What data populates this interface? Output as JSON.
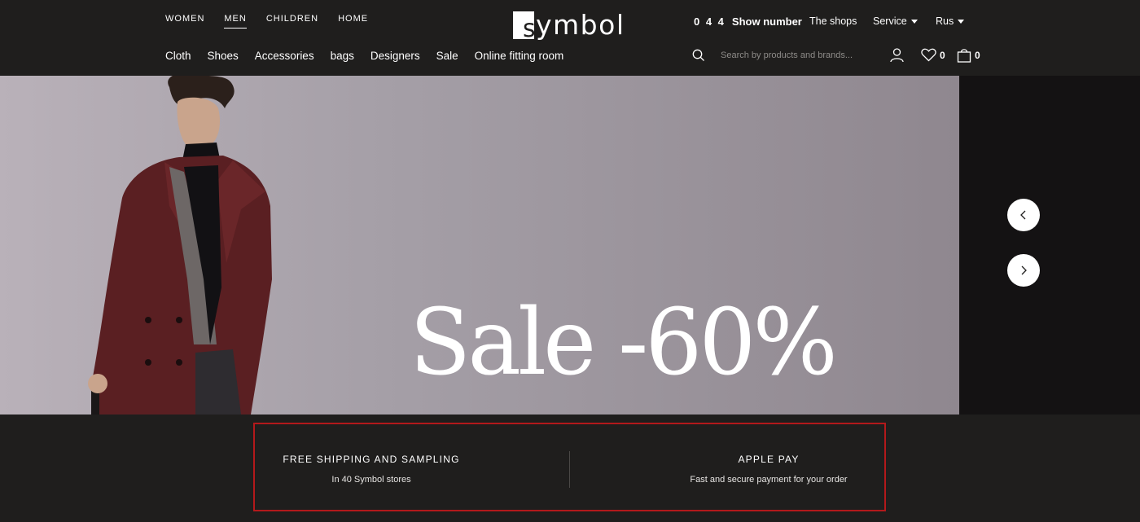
{
  "header": {
    "top_nav": [
      "WOMEN",
      "MEN",
      "CHILDREN",
      "HOME"
    ],
    "top_nav_active": "MEN",
    "categories": [
      "Cloth",
      "Shoes",
      "Accessories",
      "bags",
      "Designers",
      "Sale",
      "Online fitting room"
    ],
    "logo": {
      "boxed_letter": "s",
      "rest": "ymbol"
    },
    "phone": {
      "code": "0 4 4",
      "action": "Show number"
    },
    "shops_label": "The shops",
    "service_label": "Service",
    "language": "Rus",
    "search": {
      "placeholder": "Search by products and brands..."
    },
    "wishlist_count": "0",
    "cart_count": "0",
    "icons": [
      "search-icon",
      "user-icon",
      "heart-icon",
      "bag-icon",
      "caret-down-icon"
    ]
  },
  "banner": {
    "headline": "Sale -60%",
    "colors": {
      "background": "#a59fa7",
      "coat": "#5a1f22",
      "dark_side": "#141213"
    }
  },
  "carousel": {
    "prev_icon": "chevron-left-icon",
    "next_icon": "chevron-right-icon"
  },
  "features": [
    {
      "title": "FREE SHIPPING AND SAMPLING",
      "subtitle": "In 40 Symbol stores"
    },
    {
      "title": "APPLE PAY",
      "subtitle": "Fast and secure payment for your order"
    }
  ],
  "colors": {
    "page_bg": "#1f1e1d",
    "highlight_border": "#b3191b",
    "text": "#ffffff"
  }
}
